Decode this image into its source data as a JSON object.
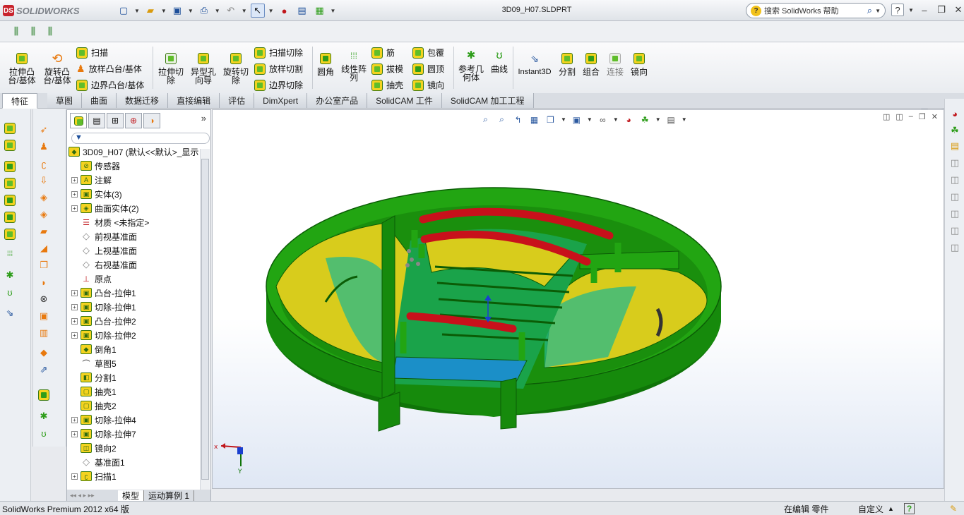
{
  "app": {
    "brand": "SOLIDWORKS",
    "document_title": "3D09_H07.SLDPRT"
  },
  "help": {
    "placeholder": "搜索 SolidWorks 帮助"
  },
  "ribbon": {
    "extrude_boss": "拉伸凸\n台/基体",
    "revolve_boss": "旋转凸\n台/基体",
    "sweep": "扫描",
    "loft_boss": "放样凸台/基体",
    "boundary_boss": "边界凸台/基体",
    "extrude_cut": "拉伸切\n除",
    "hole_wizard": "异型孔\n向导",
    "revolve_cut": "旋转切\n除",
    "swept_cut": "扫描切除",
    "lofted_cut": "放样切割",
    "boundary_cut": "边界切除",
    "fillet": "圆角",
    "linear_pattern": "线性阵\n列",
    "rib": "筋",
    "draft": "拔模",
    "shell": "抽壳",
    "wrap": "包覆",
    "dome": "圆顶",
    "mirror_small": "镜向",
    "ref_geometry": "参考几\n何体",
    "curves": "曲线",
    "instant3d": "Instant3D",
    "split": "分割",
    "combine": "组合",
    "join": "连接",
    "mirror": "镜向"
  },
  "tabs": [
    "特征",
    "草图",
    "曲面",
    "数据迁移",
    "直接编辑",
    "评估",
    "DimXpert",
    "办公室产品",
    "SolidCAM 工件",
    "SolidCAM 加工工程"
  ],
  "tree": {
    "root": "3D09_H07  (默认<<默认>_显示",
    "items": [
      {
        "label": "传感器",
        "exp": false,
        "icon": "sensor-icon"
      },
      {
        "label": "注解",
        "exp": true,
        "icon": "annotation-icon"
      },
      {
        "label": "实体(3)",
        "exp": true,
        "icon": "solid-bodies-icon"
      },
      {
        "label": "曲面实体(2)",
        "exp": true,
        "icon": "surface-bodies-icon"
      },
      {
        "label": "材质 <未指定>",
        "exp": false,
        "icon": "material-icon"
      },
      {
        "label": "前视基准面",
        "exp": false,
        "icon": "plane-icon"
      },
      {
        "label": "上视基准面",
        "exp": false,
        "icon": "plane-icon"
      },
      {
        "label": "右视基准面",
        "exp": false,
        "icon": "plane-icon"
      },
      {
        "label": "原点",
        "exp": false,
        "icon": "origin-icon"
      },
      {
        "label": "凸台-拉伸1",
        "exp": true,
        "icon": "extrude-icon"
      },
      {
        "label": "切除-拉伸1",
        "exp": true,
        "icon": "cut-icon"
      },
      {
        "label": "凸台-拉伸2",
        "exp": true,
        "icon": "extrude-icon"
      },
      {
        "label": "切除-拉伸2",
        "exp": true,
        "icon": "cut-icon"
      },
      {
        "label": "倒角1",
        "exp": false,
        "icon": "chamfer-icon"
      },
      {
        "label": "草图5",
        "exp": false,
        "icon": "sketch-icon"
      },
      {
        "label": "分割1",
        "exp": false,
        "icon": "split-icon"
      },
      {
        "label": "抽壳1",
        "exp": false,
        "icon": "shell-icon"
      },
      {
        "label": "抽壳2",
        "exp": false,
        "icon": "shell-icon"
      },
      {
        "label": "切除-拉伸4",
        "exp": true,
        "icon": "cut-icon"
      },
      {
        "label": "切除-拉伸7",
        "exp": true,
        "icon": "cut-icon"
      },
      {
        "label": "镜向2",
        "exp": false,
        "icon": "mirror-icon"
      },
      {
        "label": "基准面1",
        "exp": false,
        "icon": "plane-icon"
      },
      {
        "label": "扫描1",
        "exp": true,
        "icon": "sweep-icon"
      }
    ]
  },
  "bottom_tabs": {
    "model": "模型",
    "motion": "运动算例 1"
  },
  "status": {
    "product": "SolidWorks Premium 2012 x64 版",
    "mode": "在编辑 零件",
    "units": "自定义"
  },
  "colors": {
    "model_green": "#1fa00f",
    "model_yellow": "#d8cc1c",
    "model_teal": "#27b98a",
    "model_red": "#c8111b",
    "model_blue": "#1b8fc8"
  }
}
